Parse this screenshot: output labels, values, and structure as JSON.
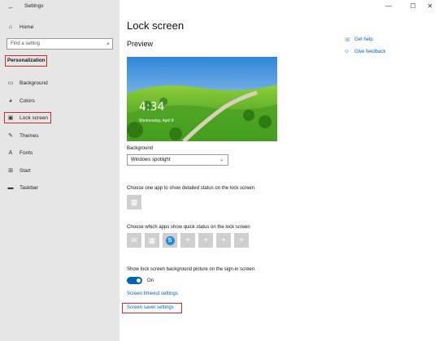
{
  "window": {
    "title": "Settings",
    "controls": [
      "—",
      "☐",
      "✕"
    ]
  },
  "sidebar": {
    "home": "Home",
    "search_placeholder": "Find a setting",
    "section": "Personalization",
    "items": [
      {
        "label": "Background",
        "icon": "picture-icon"
      },
      {
        "label": "Colors",
        "icon": "palette-icon"
      },
      {
        "label": "Lock screen",
        "icon": "lock-screen-icon"
      },
      {
        "label": "Themes",
        "icon": "brush-icon"
      },
      {
        "label": "Fonts",
        "icon": "font-icon"
      },
      {
        "label": "Start",
        "icon": "start-icon"
      },
      {
        "label": "Taskbar",
        "icon": "taskbar-icon"
      }
    ]
  },
  "main": {
    "title": "Lock screen",
    "preview_heading": "Preview",
    "preview_time": "4:34",
    "preview_date": "Wednesday, April 8",
    "background_label": "Background",
    "background_value": "Windows spotlight",
    "detailed_label": "Choose one app to show detailed status on the lock screen",
    "quick_label": "Choose which apps show quick status on the lock screen",
    "signin_label": "Show lock screen background picture on the sign-in screen",
    "toggle_state": "On",
    "timeout_link": "Screen timeout settings",
    "saver_link": "Screen saver settings",
    "tile_plus": "+"
  },
  "help": {
    "get_help": "Get help",
    "feedback": "Give feedback"
  },
  "colors": {
    "accent": "#0063b1",
    "highlight": "#d9262a"
  }
}
